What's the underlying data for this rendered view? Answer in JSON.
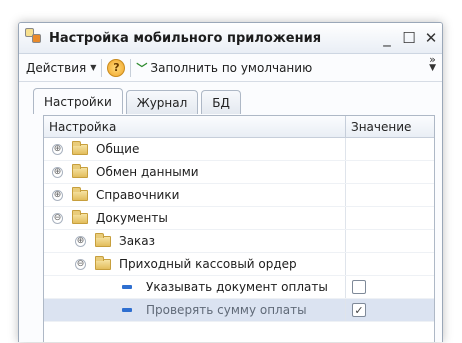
{
  "window": {
    "title": "Настройка мобильного приложения",
    "controls": {
      "minimize": "_",
      "maximize": "☐",
      "close": "✕"
    }
  },
  "toolbar": {
    "actions_label": "Действия",
    "help_label": "?",
    "fill_default_label": "Заполнить по умолчанию",
    "overflow_glyph": "»"
  },
  "tabs": [
    {
      "label": "Настройки",
      "active": true
    },
    {
      "label": "Журнал",
      "active": false
    },
    {
      "label": "БД",
      "active": false
    }
  ],
  "grid": {
    "columns": {
      "name": "Настройка",
      "value": "Значение"
    },
    "rows": [
      {
        "label": "Общие",
        "type": "folder",
        "expander": "⊕",
        "level": 0
      },
      {
        "label": "Обмен данными",
        "type": "folder",
        "expander": "⊕",
        "level": 0
      },
      {
        "label": "Справочники",
        "type": "folder",
        "expander": "⊕",
        "level": 0
      },
      {
        "label": "Документы",
        "type": "folder",
        "expander": "⊖",
        "level": 0
      },
      {
        "label": "Заказ",
        "type": "folder",
        "expander": "⊕",
        "level": 1
      },
      {
        "label": "Приходный кассовый ордер",
        "type": "folder",
        "expander": "⊖",
        "level": 1
      },
      {
        "label": "Указывать документ оплаты",
        "type": "parameter",
        "checked": false,
        "level": 2
      },
      {
        "label": "Проверять сумму оплаты",
        "type": "parameter",
        "checked": true,
        "level": 2,
        "selected": true
      }
    ]
  },
  "colors": {
    "accent": "#2f6fd0",
    "selected_row": "#dbe3f1",
    "folder": "#e2bd5c"
  }
}
